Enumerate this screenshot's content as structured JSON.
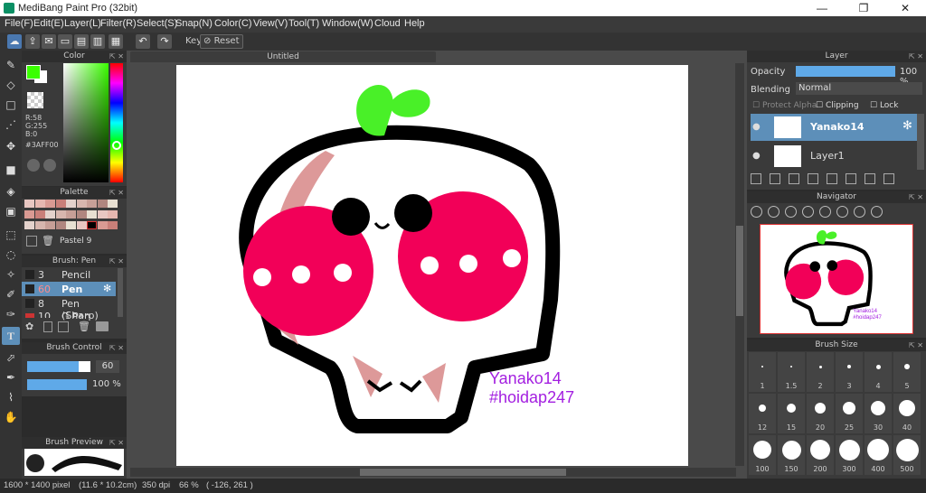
{
  "window": {
    "title": "MediBang Paint Pro (32bit)",
    "min": "—",
    "max": "❐",
    "close": "✕"
  },
  "menu": [
    "File(F)",
    "Edit(E)",
    "Layer(L)",
    "Filter(R)",
    "Select(S)",
    "Snap(N)",
    "Color(C)",
    "View(V)",
    "Tool(T)",
    "Window(W)",
    "Cloud",
    "Help"
  ],
  "toolbar": {
    "key_label": "Key",
    "reset_label": "Reset"
  },
  "color_panel": {
    "title": "Color",
    "r": "R:58",
    "g": "G:255",
    "b": "B:0",
    "hex": "#3AFF00",
    "fg_color": "#3aff00"
  },
  "palette_panel": {
    "title": "Palette",
    "name": "Pastel 9"
  },
  "brush_panel": {
    "title": "Brush: Pen",
    "items": [
      {
        "size": "3",
        "name": "Pencil"
      },
      {
        "size": "60",
        "name": "Pen"
      },
      {
        "size": "8",
        "name": "Pen (Sharp)"
      },
      {
        "size": "10",
        "name": "G Pen"
      }
    ]
  },
  "brush_control": {
    "title": "Brush Control",
    "size": "60",
    "opacity": "100 %",
    "size_fraction": 0.82,
    "opacity_fraction": 1.0
  },
  "brush_preview": {
    "title": "Brush Preview"
  },
  "document": {
    "tab": "Untitled",
    "text_line1": "Yanako14",
    "text_line2": "#hoidap247"
  },
  "layer_panel": {
    "title": "Layer",
    "opacity_label": "Opacity",
    "opacity_value": "100 %",
    "blending_label": "Blending",
    "blending_value": "Normal",
    "protect_alpha": "Protect Alpha",
    "clipping": "Clipping",
    "lock": "Lock",
    "layers": [
      {
        "name": "Yanako14"
      },
      {
        "name": "Layer1"
      }
    ]
  },
  "navigator": {
    "title": "Navigator",
    "text_line1": "Yanako14",
    "text_line2": "#hoidap247"
  },
  "brush_size": {
    "title": "Brush Size",
    "sizes": [
      "1",
      "1.5",
      "2",
      "3",
      "4",
      "5",
      "12",
      "15",
      "20",
      "25",
      "30",
      "40",
      "100",
      "150",
      "200",
      "300",
      "400",
      "500"
    ]
  },
  "status": {
    "dimensions": "1600 * 1400 pixel",
    "cm": "(11.6 * 10.2cm)",
    "dpi": "350 dpi",
    "zoom": "66 %",
    "coords": "( -126, 261 )"
  }
}
